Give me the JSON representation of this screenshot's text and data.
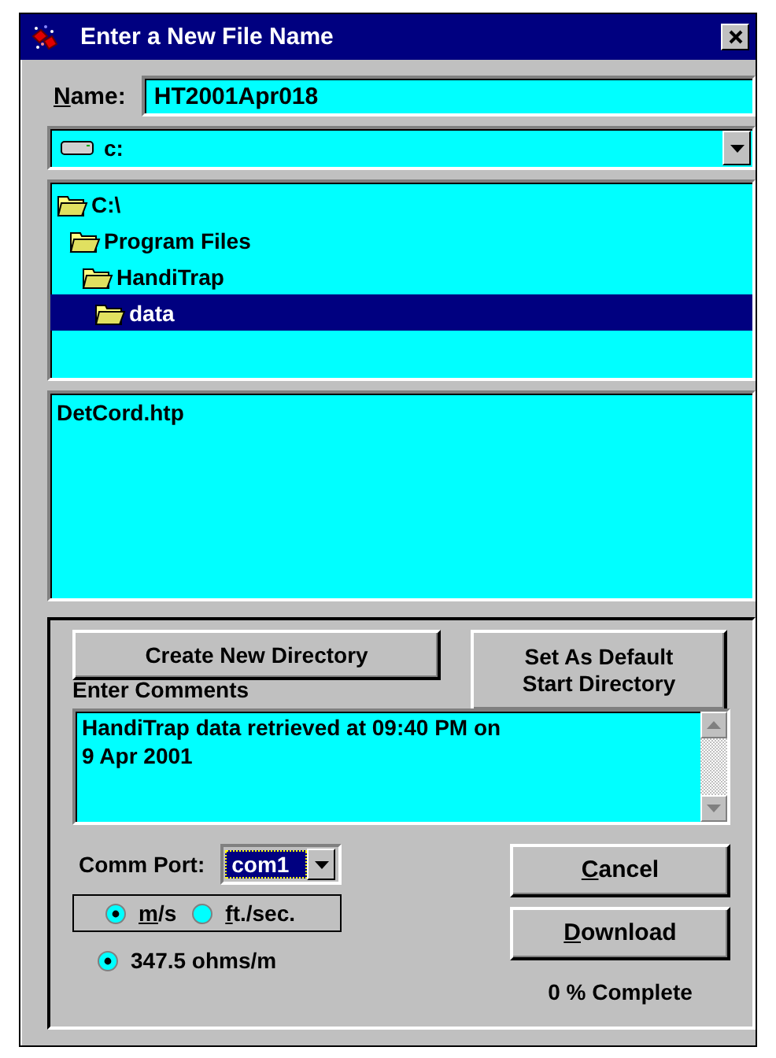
{
  "window": {
    "title": "Enter a New File Name"
  },
  "name_field": {
    "label": "Name:",
    "value": "HT2001Apr018"
  },
  "drive_combo": {
    "value": "c:"
  },
  "directory_tree": [
    {
      "label": "C:\\",
      "selected": false,
      "children": [
        {
          "label": "Program Files",
          "selected": false,
          "children": [
            {
              "label": "HandiTrap",
              "selected": false,
              "children": [
                {
                  "label": "data",
                  "selected": true
                }
              ]
            }
          ]
        }
      ]
    }
  ],
  "file_list": [
    {
      "label": "DetCord.htp",
      "selected": false
    }
  ],
  "directory_buttons": [
    {
      "label": "Create New Directory"
    },
    {
      "label": "Set As Default\nStart Directory"
    }
  ],
  "comments": {
    "label": "Enter Comments",
    "value": "HandiTrap data retrieved at 09:40 PM on\n9 Apr 2001"
  },
  "comm_port": {
    "label": "Comm Port:",
    "value": "com1"
  },
  "speed_units": [
    {
      "label": "m/s",
      "selected": true
    },
    {
      "label": "ft./sec.",
      "selected": false
    }
  ],
  "resistance": {
    "label": "347.5 ohms/m",
    "selected": true
  },
  "action_buttons": [
    {
      "label": "Cancel"
    },
    {
      "label": "Download"
    }
  ],
  "progress_text": "0 % Complete"
}
